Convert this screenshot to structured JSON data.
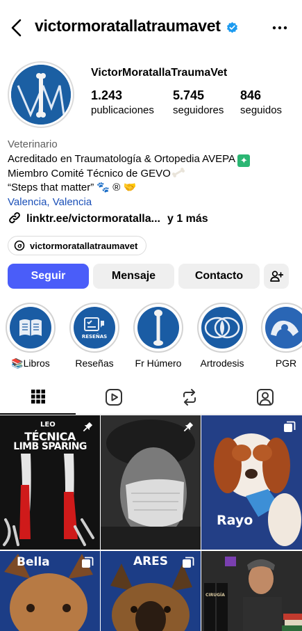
{
  "header": {
    "username": "victormoratallatraumavet",
    "back_icon": "chevron-left-icon",
    "verified_icon": "verified-badge-icon",
    "more_icon": "more-horizontal-icon"
  },
  "profile": {
    "display_name": "VictorMoratallaTraumaVet",
    "stats": {
      "posts_count": "1.243",
      "posts_label": "publicaciones",
      "followers_count": "5.745",
      "followers_label": "seguidores",
      "following_count": "846",
      "following_label": "seguidos"
    },
    "bio": {
      "category": "Veterinario",
      "line1": "Acreditado en Traumatología & Ortopedia AVEPA",
      "line2": "Miembro Comité Técnico de GEVO",
      "line3": "“Steps that matter”",
      "location": "Valencia, Valencia"
    },
    "link": {
      "url": "linktr.ee/victormoratalla...",
      "more": "y 1 más"
    },
    "threads_handle": "victormoratallatraumavet"
  },
  "actions": {
    "follow": "Seguir",
    "message": "Mensaje",
    "contact": "Contacto"
  },
  "highlights": [
    {
      "label": "📚Libros"
    },
    {
      "label": "Reseñas",
      "inner_text": "RESEÑAS"
    },
    {
      "label": "Fr Húmero"
    },
    {
      "label": "Artrodesis"
    },
    {
      "label": "PGR"
    }
  ],
  "tabs": [
    "grid-icon",
    "reels-icon",
    "reposts-icon",
    "tagged-icon"
  ],
  "posts": [
    {
      "title_small": "LEO",
      "title": "TÉCNICA",
      "title2": "LIMB SPARING",
      "pinned": true
    },
    {
      "pinned": true
    },
    {
      "caption": "Rayo",
      "multi": true
    },
    {
      "caption": "Bella",
      "multi": true
    },
    {
      "caption": "ARES",
      "multi": true
    },
    {
      "caption": "CIRUGÍA"
    }
  ],
  "colors": {
    "accent": "#4a5df9",
    "link": "#1a4fb7",
    "brand_blue": "#1b5fa3"
  }
}
